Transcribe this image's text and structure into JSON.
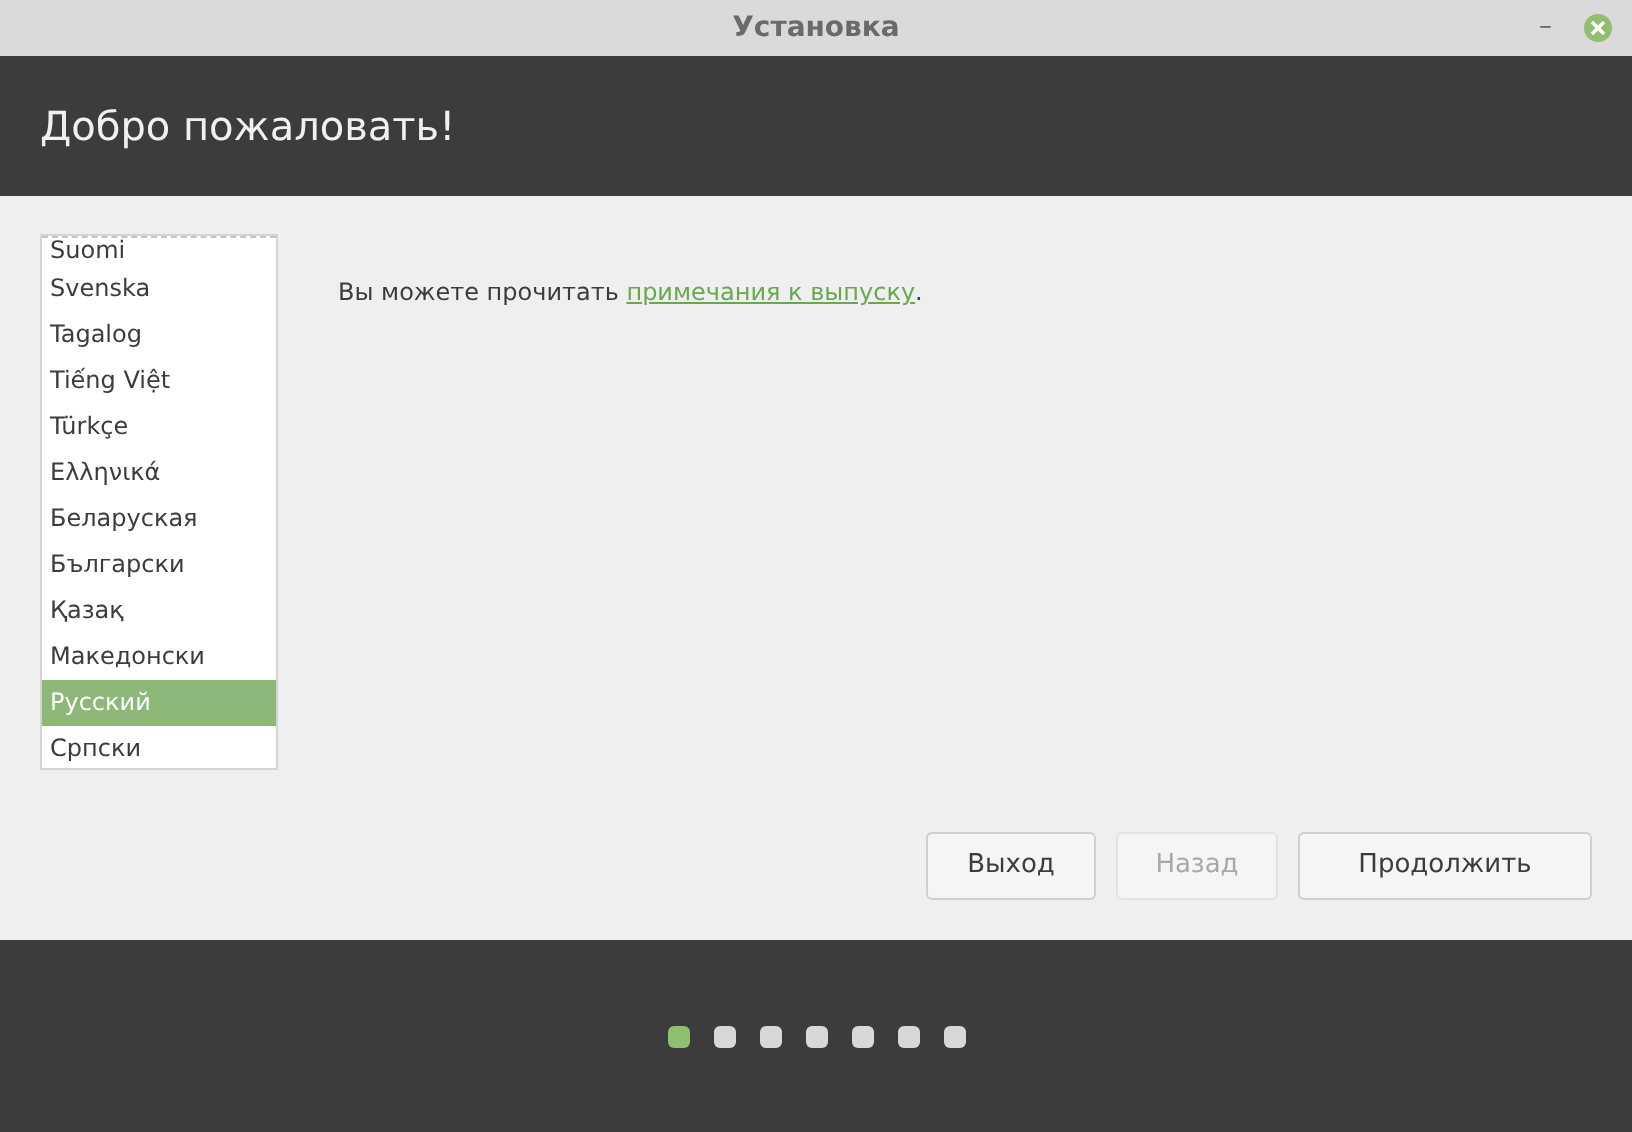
{
  "window": {
    "title": "Установка",
    "minimize": "–"
  },
  "header": {
    "title": "Добро пожаловать!"
  },
  "languages": [
    {
      "label": "Suomi",
      "selected": false
    },
    {
      "label": "Svenska",
      "selected": false
    },
    {
      "label": "Tagalog",
      "selected": false
    },
    {
      "label": "Tiếng Việt",
      "selected": false
    },
    {
      "label": "Türkçe",
      "selected": false
    },
    {
      "label": "Ελληνικά",
      "selected": false
    },
    {
      "label": "Беларуская",
      "selected": false
    },
    {
      "label": "Български",
      "selected": false
    },
    {
      "label": "Қазақ",
      "selected": false
    },
    {
      "label": "Македонски",
      "selected": false
    },
    {
      "label": "Русский",
      "selected": true
    },
    {
      "label": "Српски",
      "selected": false
    }
  ],
  "release_notes": {
    "before": "Вы можете прочитать ",
    "link": "примечания к выпуску",
    "after": "."
  },
  "buttons": [
    {
      "label": "Выход",
      "disabled": false
    },
    {
      "label": "Назад",
      "disabled": true
    },
    {
      "label": "Продолжить",
      "disabled": false
    }
  ],
  "steps": [
    {
      "selected": true
    },
    {
      "selected": false
    },
    {
      "selected": false
    },
    {
      "selected": false
    },
    {
      "selected": false
    },
    {
      "selected": false
    },
    {
      "selected": false
    }
  ]
}
